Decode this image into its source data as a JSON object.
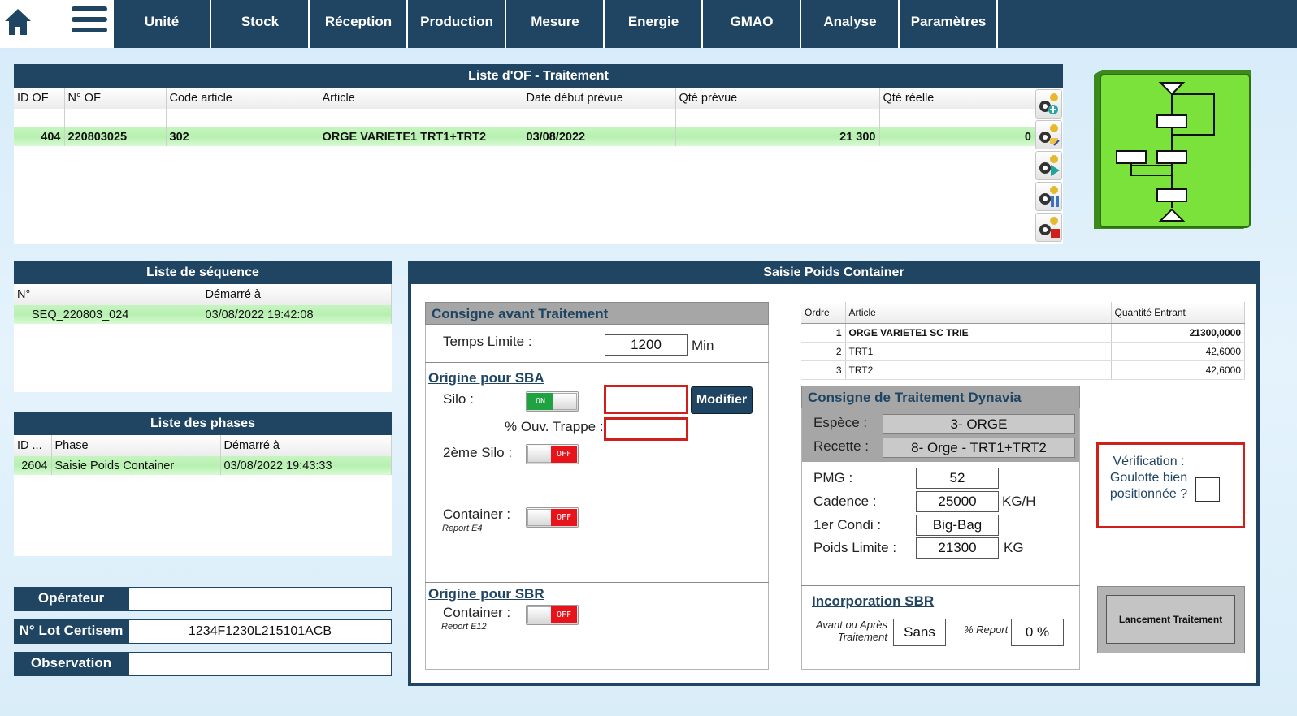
{
  "nav": {
    "home_icon": "home-icon",
    "menu_icon": "hamburger-menu-icon",
    "items": [
      "Unité",
      "Stock",
      "Réception",
      "Production",
      "Mesure",
      "Energie",
      "GMAO",
      "Analyse",
      "Paramètres"
    ]
  },
  "of_list": {
    "title": "Liste d'OF - Traitement",
    "columns": [
      "ID OF",
      "N° OF",
      "Code article",
      "Article",
      "Date début prévue",
      "Qté prévue",
      "Qté réelle"
    ],
    "rows": [
      {
        "id": "404",
        "num": "220803025",
        "code": "302",
        "article": "ORGE VARIETE1 TRT1+TRT2",
        "date": "03/08/2022",
        "qte_prevue": "21 300",
        "qte_reelle": "0"
      }
    ],
    "action_icons": [
      "gear-add-icon",
      "gear-edit-icon",
      "gear-play-icon",
      "gear-pause-icon",
      "gear-stop-icon"
    ]
  },
  "flow_icon": "flowchart-icon",
  "sequence": {
    "title": "Liste de séquence",
    "columns": [
      "N°",
      "Démarré à"
    ],
    "rows": [
      {
        "num": "SEQ_220803_024",
        "start": "03/08/2022 19:42:08"
      }
    ]
  },
  "phases": {
    "title": "Liste des phases",
    "columns": [
      "ID ...",
      "Phase",
      "Démarré à"
    ],
    "rows": [
      {
        "id": "2604",
        "phase": "Saisie Poids Container",
        "start": "03/08/2022 19:43:33"
      }
    ]
  },
  "operator": {
    "operateur_label": "Opérateur",
    "operateur_value": "",
    "lot_label": "N° Lot Certisem",
    "lot_value": "1234F1230L215101ACB",
    "obs_label": "Observation",
    "obs_value": ""
  },
  "saisie": {
    "title": "Saisie Poids Container",
    "consigne_avant": {
      "title": "Consigne avant Traitement",
      "temps_label": "Temps Limite :",
      "temps_value": "1200",
      "temps_unit": "Min"
    },
    "sba": {
      "title": "Origine pour SBA",
      "silo_label": "Silo :",
      "silo_toggle": "ON",
      "trappe_label": "% Ouv. Trappe :",
      "modifier_label": "Modifier",
      "silo2_label": "2ème Silo :",
      "silo2_toggle": "OFF",
      "container_label": "Container :",
      "container_toggle": "OFF",
      "container_note": "Report E4"
    },
    "sbr": {
      "title": "Origine pour SBR",
      "container_label": "Container :",
      "container_toggle": "OFF",
      "container_note": "Report E12"
    },
    "ordre_table": {
      "columns": [
        "Ordre",
        "Article",
        "Quantité Entrant"
      ],
      "rows": [
        {
          "ordre": "1",
          "article": "ORGE VARIETE1 SC TRIE",
          "qte": "21300,0000"
        },
        {
          "ordre": "2",
          "article": "TRT1",
          "qte": "42,6000"
        },
        {
          "ordre": "3",
          "article": "TRT2",
          "qte": "42,6000"
        }
      ]
    },
    "dynavia": {
      "title": "Consigne de Traitement Dynavia",
      "espece_label": "Espèce :",
      "espece_value": "3- ORGE",
      "recette_label": "Recette :",
      "recette_value": "8- Orge - TRT1+TRT2",
      "pmg_label": "PMG :",
      "pmg_value": "52",
      "cadence_label": "Cadence :",
      "cadence_value": "25000",
      "cadence_unit": "KG/H",
      "condi_label": "1er Condi :",
      "condi_value": "Big-Bag",
      "poids_label": "Poids Limite :",
      "poids_value": "21300",
      "poids_unit": "KG"
    },
    "incorporation": {
      "title": "Incorporation SBR",
      "avant_label_1": "Avant ou Après",
      "avant_label_2": "Traitement",
      "avant_value": "Sans",
      "report_label": "% Report",
      "report_value": "0 %"
    },
    "verification": {
      "line1": "Vérification :",
      "line2": "Goulotte bien",
      "line3": "positionnée ?"
    },
    "launch_label": "Lancement Traitement"
  }
}
